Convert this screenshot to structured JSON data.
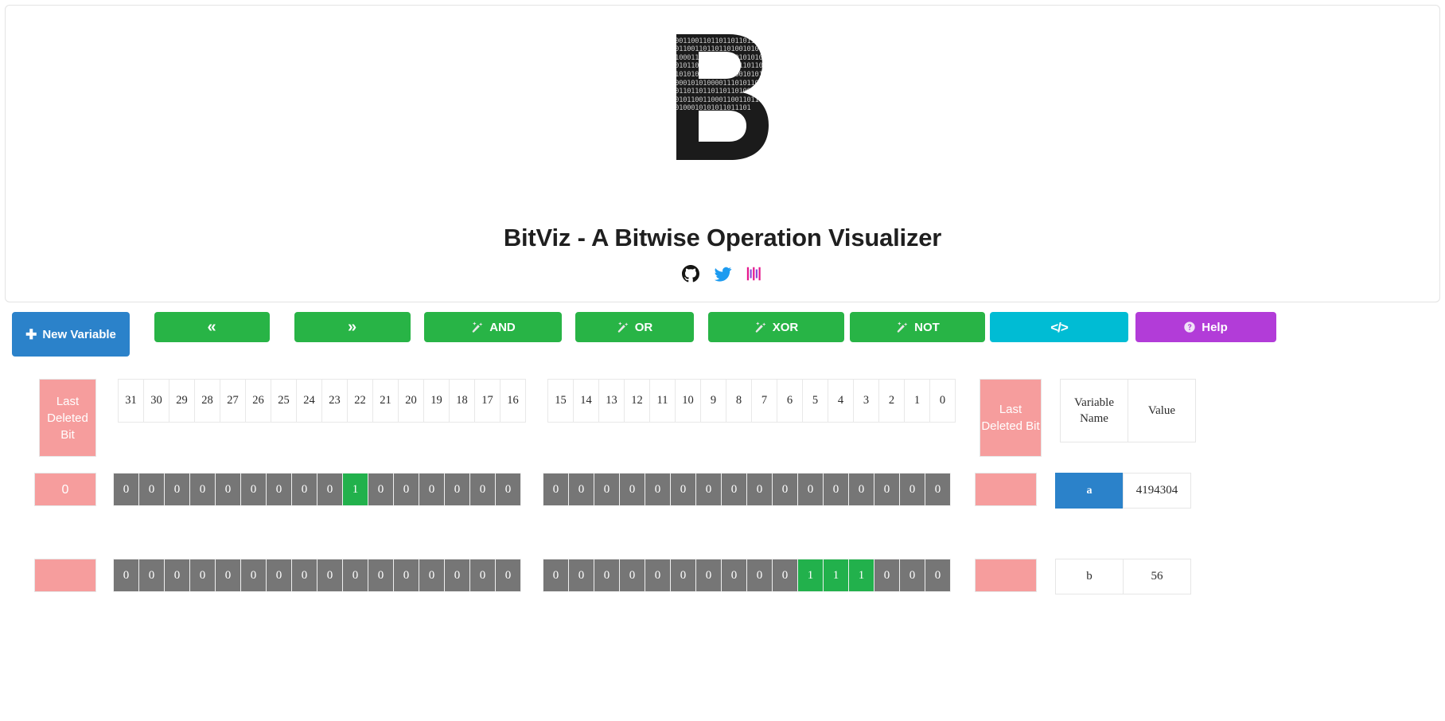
{
  "header": {
    "logo_letter": "B",
    "logo_icon": "binary-b-logo",
    "logo_bits": "0010101001111001101011101011001100011001101101101101101100110110110011011011010010100011010101000110101010010101010101101110101100110001100110110110110101010101101010110010101101010110001010100001110101100001011010110110110110110100110101011010101100110001100110110110101010100010101011011101",
    "title": "BitViz - A Bitwise Operation Visualizer",
    "socials": [
      {
        "name": "github-icon",
        "label": "GitHub"
      },
      {
        "name": "twitter-icon",
        "label": "Twitter"
      },
      {
        "name": "bars-icon",
        "label": "Bars"
      }
    ]
  },
  "toolbar": {
    "new_variable": "New Variable",
    "shift_left": "«",
    "shift_right": "»",
    "and": "AND",
    "or": "OR",
    "xor": "XOR",
    "not": "NOT",
    "code": "</>",
    "help": "Help",
    "colors": {
      "primary": "#2b82ca",
      "green": "#28b446",
      "teal": "#00bcd4",
      "purple": "#b23cd8",
      "pink": "#f69d9d",
      "bit_off": "#767676",
      "bit_on": "#22b14c"
    }
  },
  "grid": {
    "last_deleted_bit_label": "Last Deleted Bit",
    "indices_left": [
      31,
      30,
      29,
      28,
      27,
      26,
      25,
      24,
      23,
      22,
      21,
      20,
      19,
      18,
      17,
      16
    ],
    "indices_right": [
      15,
      14,
      13,
      12,
      11,
      10,
      9,
      8,
      7,
      6,
      5,
      4,
      3,
      2,
      1,
      0
    ],
    "table_headers": {
      "name": "Variable Name",
      "value": "Value"
    },
    "rows": [
      {
        "name": "a",
        "value": "4194304",
        "selected": true,
        "last_deleted_bit": "0",
        "bits_left": [
          "0",
          "0",
          "0",
          "0",
          "0",
          "0",
          "0",
          "0",
          "0",
          "1",
          "0",
          "0",
          "0",
          "0",
          "0",
          "0"
        ],
        "bits_right": [
          "0",
          "0",
          "0",
          "0",
          "0",
          "0",
          "0",
          "0",
          "0",
          "0",
          "0",
          "0",
          "0",
          "0",
          "0",
          "0"
        ]
      },
      {
        "name": "b",
        "value": "56",
        "selected": false,
        "last_deleted_bit": "",
        "bits_left": [
          "0",
          "0",
          "0",
          "0",
          "0",
          "0",
          "0",
          "0",
          "0",
          "0",
          "0",
          "0",
          "0",
          "0",
          "0",
          "0"
        ],
        "bits_right": [
          "0",
          "0",
          "0",
          "0",
          "0",
          "0",
          "0",
          "0",
          "0",
          "0",
          "1",
          "1",
          "1",
          "0",
          "0",
          "0"
        ]
      }
    ]
  }
}
